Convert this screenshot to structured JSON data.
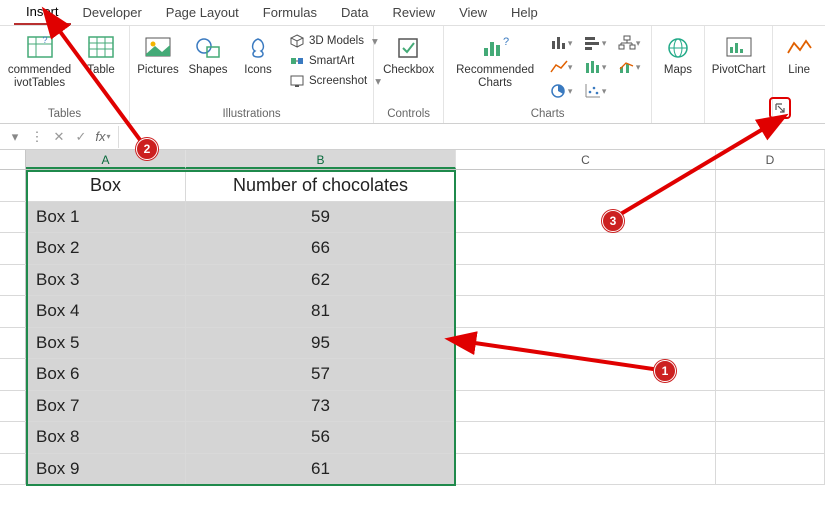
{
  "tabs": [
    "Insert",
    "Developer",
    "Page Layout",
    "Formulas",
    "Data",
    "Review",
    "View",
    "Help"
  ],
  "active_tab": "Insert",
  "ribbon": {
    "tables": {
      "rec_pivot": "commended\nivotTables",
      "table": "Table",
      "label": "Tables"
    },
    "illus": {
      "pictures": "Pictures",
      "shapes": "Shapes",
      "icons": "Icons",
      "models": "3D Models",
      "smartart": "SmartArt",
      "screenshot": "Screenshot",
      "label": "Illustrations"
    },
    "controls": {
      "checkbox": "Checkbox",
      "label": "Controls"
    },
    "charts": {
      "rec": "Recommended\nCharts",
      "label": "Charts"
    },
    "tours": {
      "maps": "Maps"
    },
    "pivotchart": "PivotChart",
    "spark": {
      "line": "Line"
    }
  },
  "fbar": {
    "fx": "fx"
  },
  "columns": [
    "A",
    "B",
    "C",
    "D"
  ],
  "headers": {
    "a": "Box",
    "b": "Number of chocolates"
  },
  "rows": [
    {
      "a": "Box 1",
      "b": "59"
    },
    {
      "a": "Box 2",
      "b": "66"
    },
    {
      "a": "Box 3",
      "b": "62"
    },
    {
      "a": "Box 4",
      "b": "81"
    },
    {
      "a": "Box 5",
      "b": "95"
    },
    {
      "a": "Box 6",
      "b": "57"
    },
    {
      "a": "Box 7",
      "b": "73"
    },
    {
      "a": "Box 8",
      "b": "56"
    },
    {
      "a": "Box 9",
      "b": "61"
    }
  ],
  "badges": {
    "1": "1",
    "2": "2",
    "3": "3"
  },
  "chart_data": {
    "type": "table",
    "columns": [
      "Box",
      "Number of chocolates"
    ],
    "rows": [
      [
        "Box 1",
        59
      ],
      [
        "Box 2",
        66
      ],
      [
        "Box 3",
        62
      ],
      [
        "Box 4",
        81
      ],
      [
        "Box 5",
        95
      ],
      [
        "Box 6",
        57
      ],
      [
        "Box 7",
        73
      ],
      [
        "Box 8",
        56
      ],
      [
        "Box 9",
        61
      ]
    ]
  }
}
